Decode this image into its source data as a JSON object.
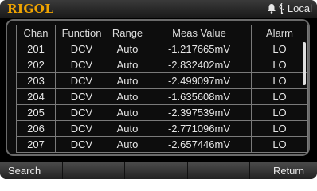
{
  "header": {
    "logo": "RIGOL",
    "status_text": "Local"
  },
  "table": {
    "columns": [
      "Chan",
      "Function",
      "Range",
      "Meas Value",
      "Alarm"
    ],
    "rows": [
      [
        "201",
        "DCV",
        "Auto",
        "-1.217665mV",
        "LO"
      ],
      [
        "202",
        "DCV",
        "Auto",
        "-2.832402mV",
        "LO"
      ],
      [
        "203",
        "DCV",
        "Auto",
        "-2.499097mV",
        "LO"
      ],
      [
        "204",
        "DCV",
        "Auto",
        "-1.635608mV",
        "LO"
      ],
      [
        "205",
        "DCV",
        "Auto",
        "-2.397539mV",
        "LO"
      ],
      [
        "206",
        "DCV",
        "Auto",
        "-2.771096mV",
        "LO"
      ],
      [
        "207",
        "DCV",
        "Auto",
        "-2.657446mV",
        "LO"
      ]
    ]
  },
  "softkeys": [
    "Search",
    "",
    "",
    "",
    "Return"
  ],
  "icons": {
    "bell": "bell-icon",
    "usb": "usb-icon"
  },
  "colors": {
    "logo": "#f0a400",
    "background": "#000000"
  }
}
